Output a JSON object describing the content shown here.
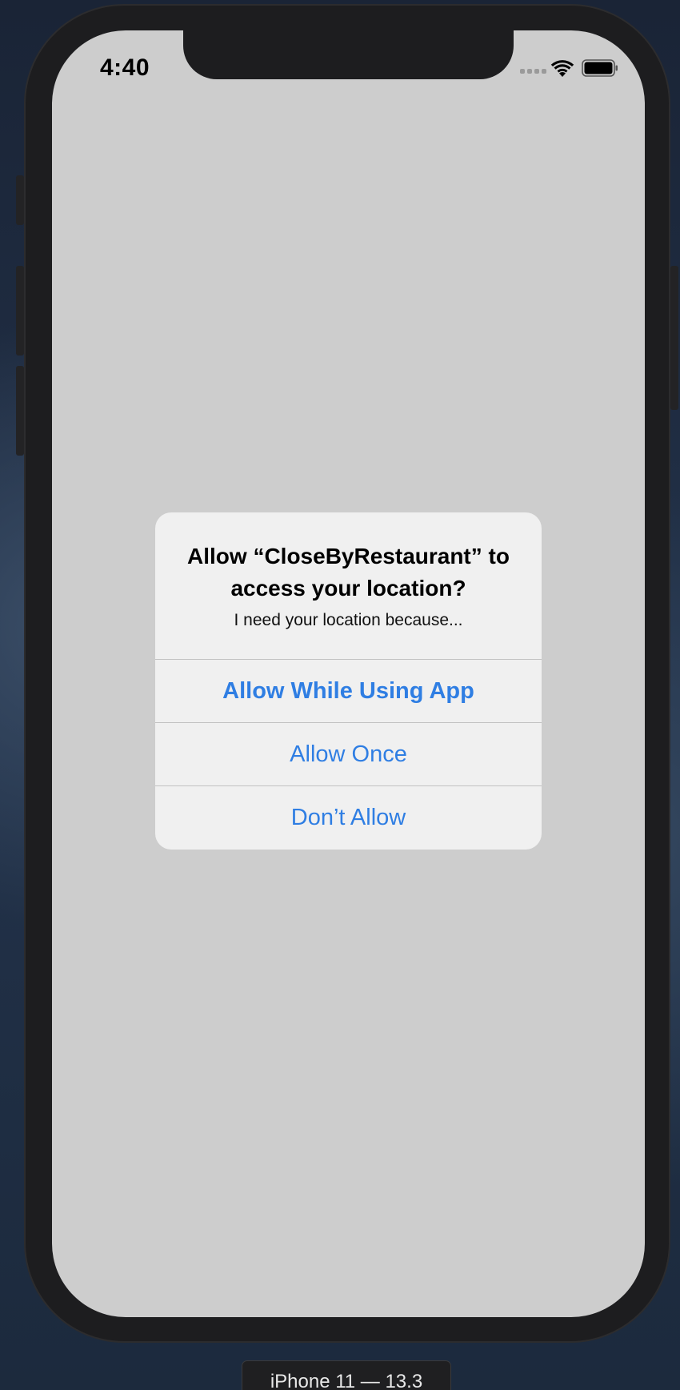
{
  "status_bar": {
    "time": "4:40"
  },
  "icons": {
    "signal": "cellular-signal-icon",
    "wifi": "wifi-icon",
    "battery": "battery-icon"
  },
  "alert": {
    "title": "Allow “CloseByRestaurant” to access your location?",
    "message": "I need your location because...",
    "buttons": [
      {
        "label": "Allow While Using App",
        "primary": true
      },
      {
        "label": "Allow Once",
        "primary": false
      },
      {
        "label": "Don’t Allow",
        "primary": false
      }
    ]
  },
  "simulator": {
    "device_label": "iPhone 11 — 13.3"
  },
  "colors": {
    "accent": "#2f7ee3",
    "screen_background": "#cdcdcd",
    "alert_background": "#f0f0f0"
  }
}
